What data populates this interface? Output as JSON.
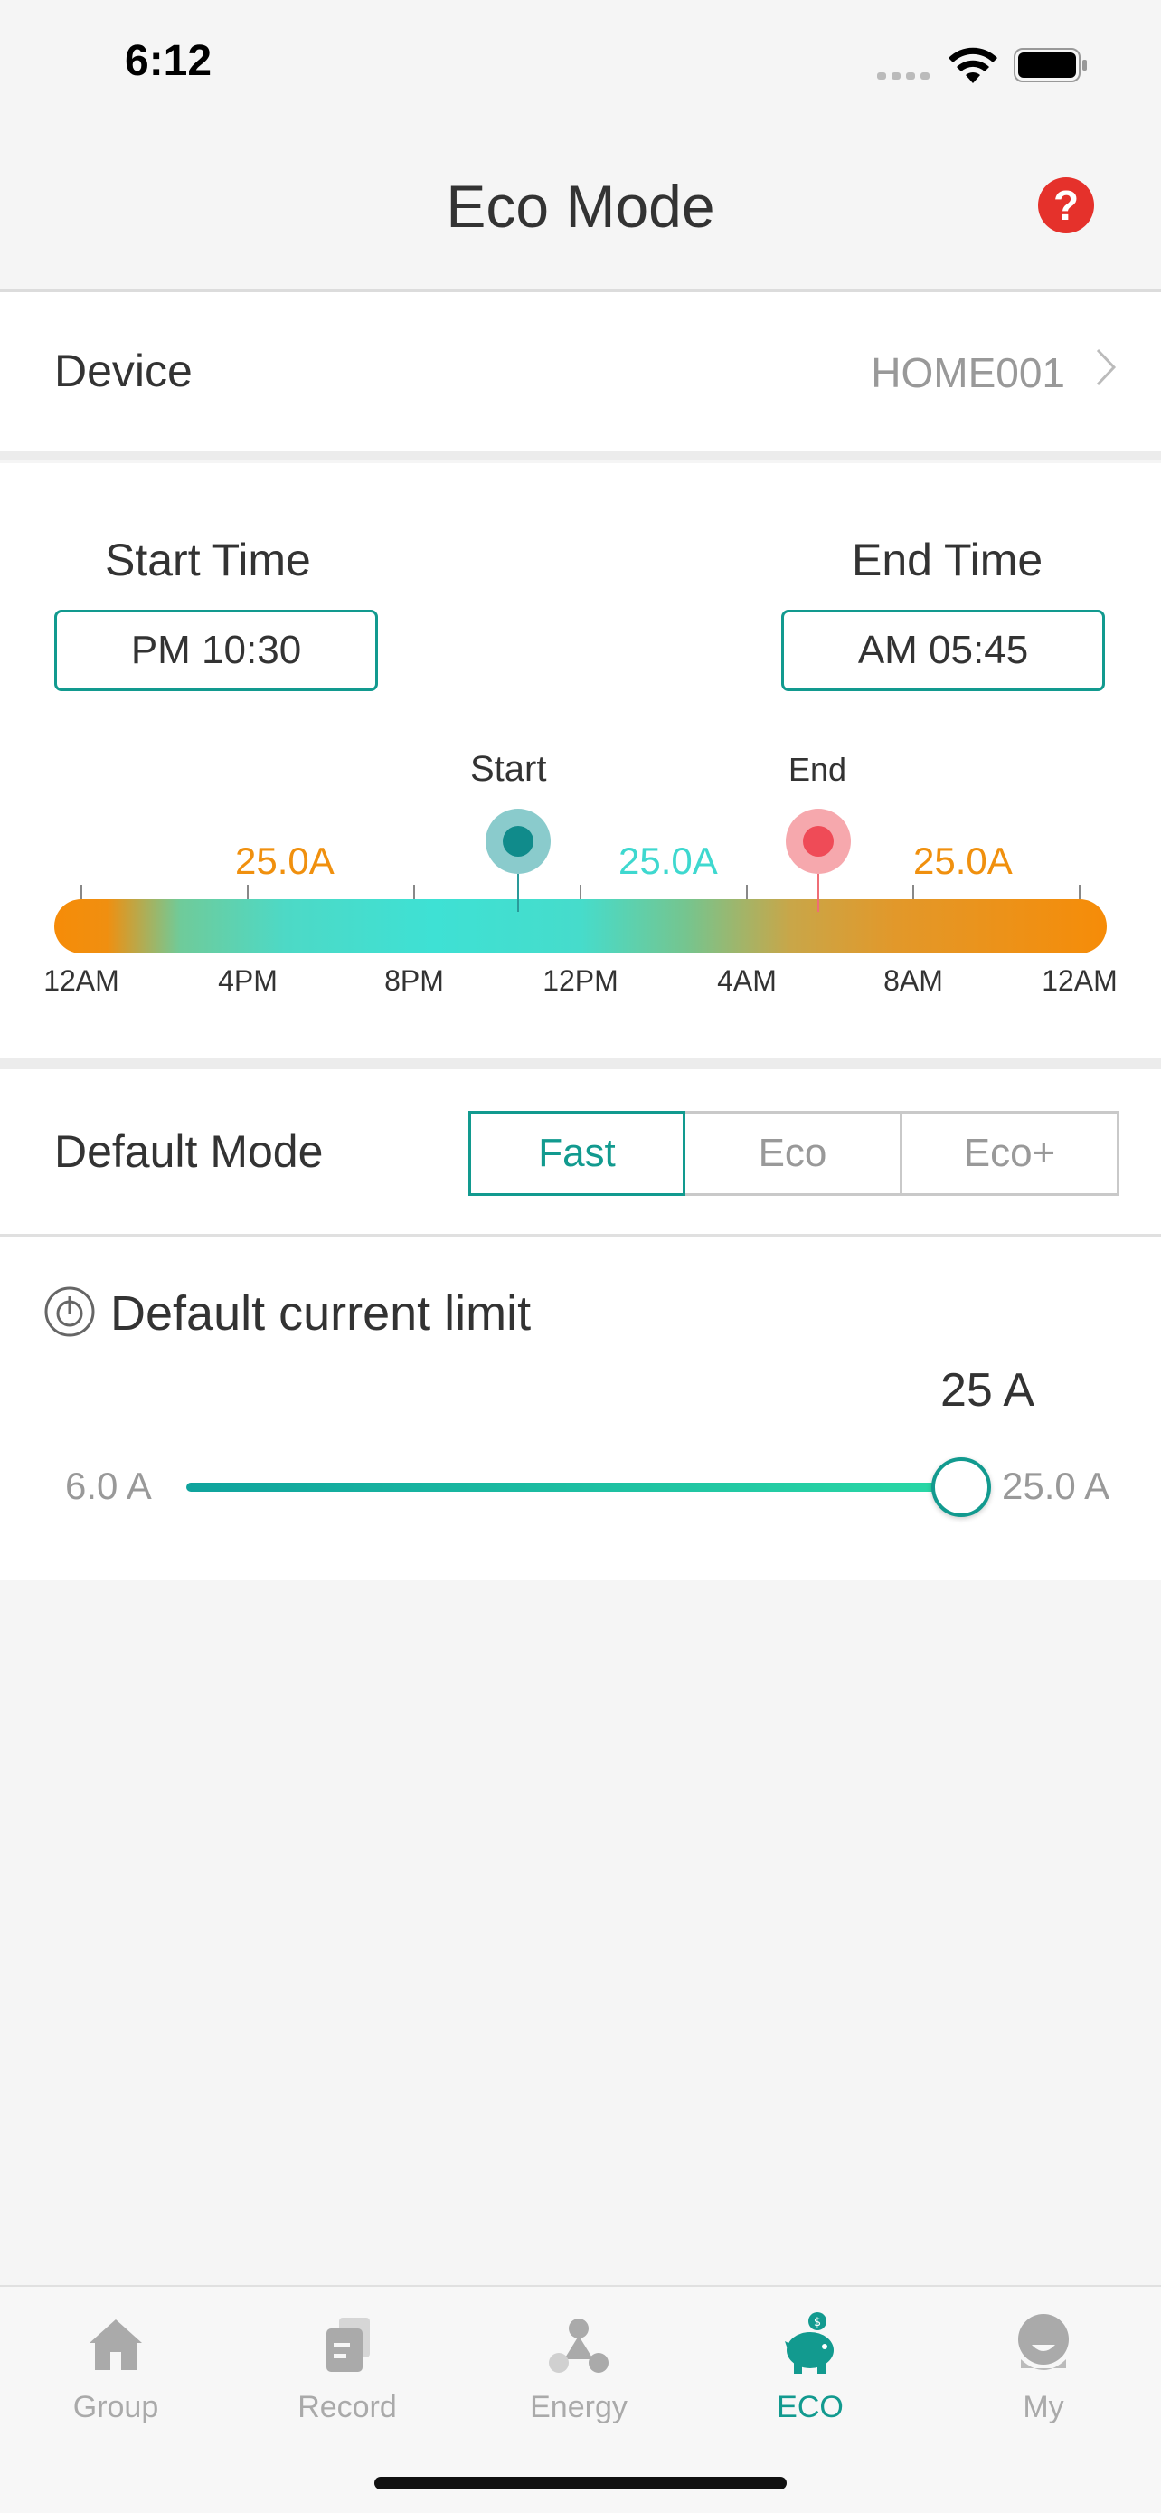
{
  "status": {
    "time": "6:12"
  },
  "nav": {
    "title": "Eco Mode",
    "help": "?"
  },
  "device": {
    "label": "Device",
    "value": "HOME001"
  },
  "schedule": {
    "start_label": "Start Time",
    "end_label": "End Time",
    "start_time": "PM 10:30",
    "end_time": "AM 05:45",
    "start_marker": "Start",
    "end_marker": "End",
    "amp_left": "25.0A",
    "amp_mid": "25.0A",
    "amp_right": "25.0A",
    "ticks": [
      "12AM",
      "4PM",
      "8PM",
      "12PM",
      "4AM",
      "8AM",
      "12AM"
    ]
  },
  "mode": {
    "label": "Default Mode",
    "options": [
      "Fast",
      "Eco",
      "Eco+"
    ],
    "selected": "Fast"
  },
  "limit": {
    "title": "Default current limit",
    "value": "25 A",
    "min": "6.0 A",
    "max": "25.0 A",
    "level": 1.0
  },
  "tabs": [
    {
      "label": "Group",
      "icon": "home-icon"
    },
    {
      "label": "Record",
      "icon": "record-icon"
    },
    {
      "label": "Energy",
      "icon": "energy-icon"
    },
    {
      "label": "ECO",
      "icon": "piggy-bank-icon"
    },
    {
      "label": "My",
      "icon": "user-icon"
    }
  ],
  "colors": {
    "accent": "#129a8f",
    "help": "#e5312b",
    "orange": "#f68c08",
    "end_marker": "#ef4b57"
  }
}
